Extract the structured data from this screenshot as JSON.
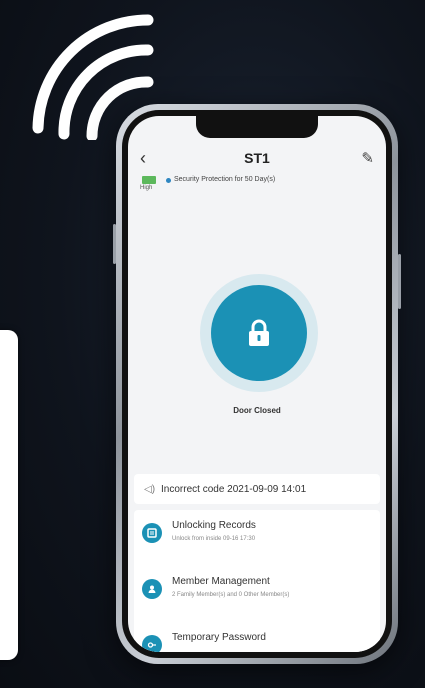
{
  "header": {
    "title": "ST1",
    "back_icon": "chevron-left-icon",
    "edit_icon": "pencil-icon"
  },
  "status": {
    "battery_label": "High",
    "protection_text": "Security Protection for 50 Day(s)"
  },
  "lock": {
    "icon": "padlock-icon",
    "door_status": "Door Closed",
    "accent_color": "#1b91b5"
  },
  "alert": {
    "icon": "speaker-icon",
    "text": "Incorrect code 2021-09-09 14:01"
  },
  "menu": [
    {
      "title": "Unlocking Records",
      "subtitle": "Unlock from inside 09-16 17:30",
      "icon": "records-icon"
    },
    {
      "title": "Member Management",
      "subtitle": "2 Family Member(s) and 0 Other Member(s)",
      "icon": "member-icon"
    },
    {
      "title": "Temporary Password",
      "subtitle": "",
      "icon": "key-icon"
    }
  ]
}
